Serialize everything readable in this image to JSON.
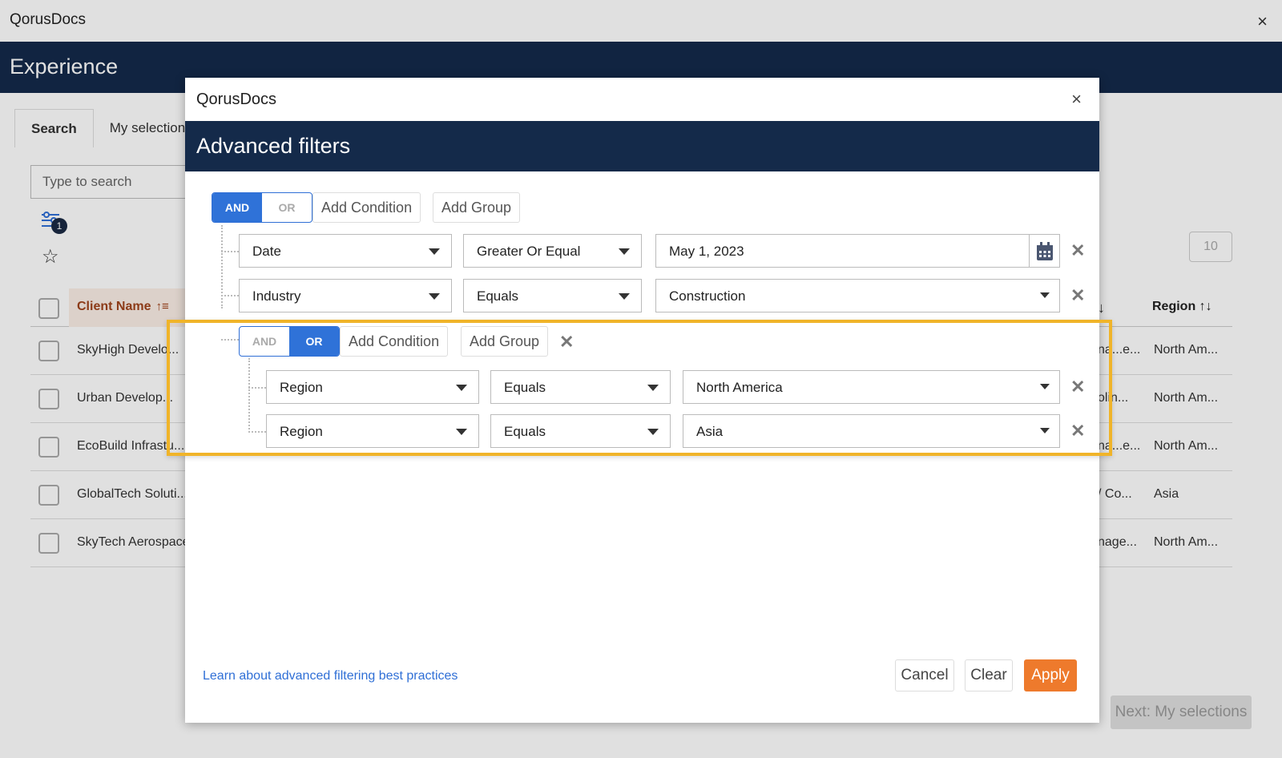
{
  "app": {
    "title": "QorusDocs",
    "close": "×",
    "header_title": "Experience",
    "tabs": [
      "Search",
      "My selection"
    ],
    "search_placeholder": "Type to search",
    "filter_badge": "1",
    "page_size": "10",
    "table": {
      "col_client": "Client Name",
      "col_region": "Region",
      "rows": [
        {
          "name": "SkyHigh Develo...",
          "mid": "na...e...",
          "region": "North Am..."
        },
        {
          "name": "Urban Develop...",
          "mid": "olin...",
          "region": "North Am..."
        },
        {
          "name": "EcoBuild Infrastu...",
          "mid": "na...e...",
          "region": "North Am..."
        },
        {
          "name": "GlobalTech Soluti...",
          "mid": "/ Co...",
          "region": "Asia"
        },
        {
          "name": "SkyTech Aerospace",
          "mid": "nage...",
          "region": "North Am..."
        }
      ]
    },
    "next_button": "Next: My selections"
  },
  "modal": {
    "app_title": "QorusDocs",
    "close": "×",
    "title": "Advanced filters",
    "root": {
      "and_label": "AND",
      "or_label": "OR",
      "active": "AND",
      "add_condition": "Add Condition",
      "add_group": "Add Group",
      "conditions": [
        {
          "field": "Date",
          "operator": "Greater Or Equal",
          "value": "May 1, 2023"
        },
        {
          "field": "Industry",
          "operator": "Equals",
          "value": "Construction"
        }
      ]
    },
    "group": {
      "and_label": "AND",
      "or_label": "OR",
      "active": "OR",
      "add_condition": "Add Condition",
      "add_group": "Add Group",
      "conditions": [
        {
          "field": "Region",
          "operator": "Equals",
          "value": "North America"
        },
        {
          "field": "Region",
          "operator": "Equals",
          "value": "Asia"
        }
      ]
    },
    "learn_link": "Learn about advanced filtering best practices",
    "cancel": "Cancel",
    "clear": "Clear",
    "apply": "Apply"
  },
  "colors": {
    "navy": "#142a4a",
    "toggle_blue": "#2f72d8",
    "apply_orange": "#ee7a2c",
    "highlight": "#f0b429",
    "link": "#2f6fd6"
  }
}
